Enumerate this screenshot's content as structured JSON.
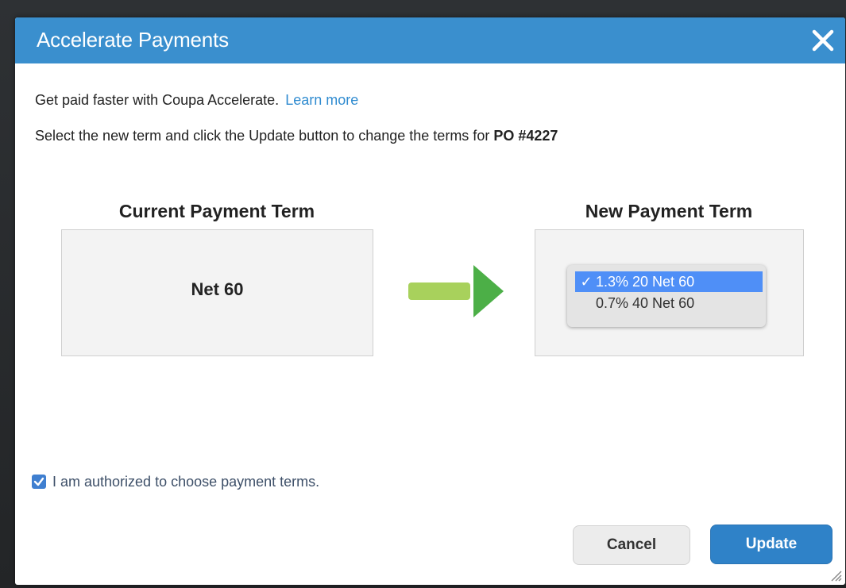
{
  "dialog": {
    "title": "Accelerate Payments",
    "close_icon": "close-icon"
  },
  "intro": {
    "text": "Get paid faster with Coupa Accelerate.",
    "link": "Learn more"
  },
  "instruction": {
    "text": "Select the new term and click the Update button to change the terms for",
    "po": "PO #4227"
  },
  "current_term": {
    "heading": "Current Payment Term",
    "value": "Net 60"
  },
  "arrow_icon": "right-arrow-icon",
  "new_term": {
    "heading": "New Payment Term",
    "options": [
      {
        "check": "✓",
        "label": "1.3% 20 Net 60",
        "selected": true
      },
      {
        "check": "",
        "label": "0.7% 40 Net 60",
        "selected": false
      }
    ]
  },
  "authorization": {
    "label": "I am authorized to choose payment terms.",
    "checked": true
  },
  "buttons": {
    "cancel": "Cancel",
    "update": "Update"
  },
  "colors": {
    "header": "#3a8fce",
    "link": "#2f8bd0",
    "update_button": "#2f82c8",
    "selected_option": "#4f8ff7",
    "arrow_body": "#a8d15c",
    "arrow_head": "#4caf47"
  }
}
